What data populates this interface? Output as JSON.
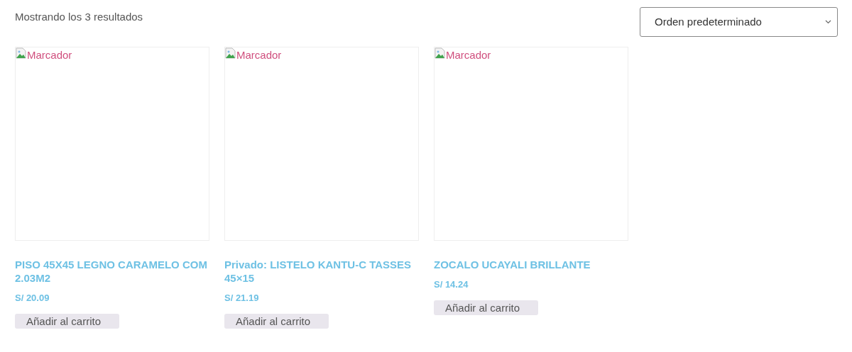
{
  "result_count": "Mostrando los 3 resultados",
  "sort_select": {
    "value": "Orden predeterminado"
  },
  "products": [
    {
      "image_alt": "Marcador",
      "title": "PISO 45X45 LEGNO CARAMELO COM 2.03M2",
      "price": "S/ 20.09",
      "button": "Añadir al carrito"
    },
    {
      "image_alt": "Marcador",
      "title": "Privado: LISTELO KANTU-C TASSES 45×15",
      "price": "S/ 21.19",
      "button": "Añadir al carrito"
    },
    {
      "image_alt": "Marcador",
      "title": "ZOCALO UCAYALI BRILLANTE",
      "price": "S/ 14.24",
      "button": "Añadir al carrito"
    }
  ]
}
